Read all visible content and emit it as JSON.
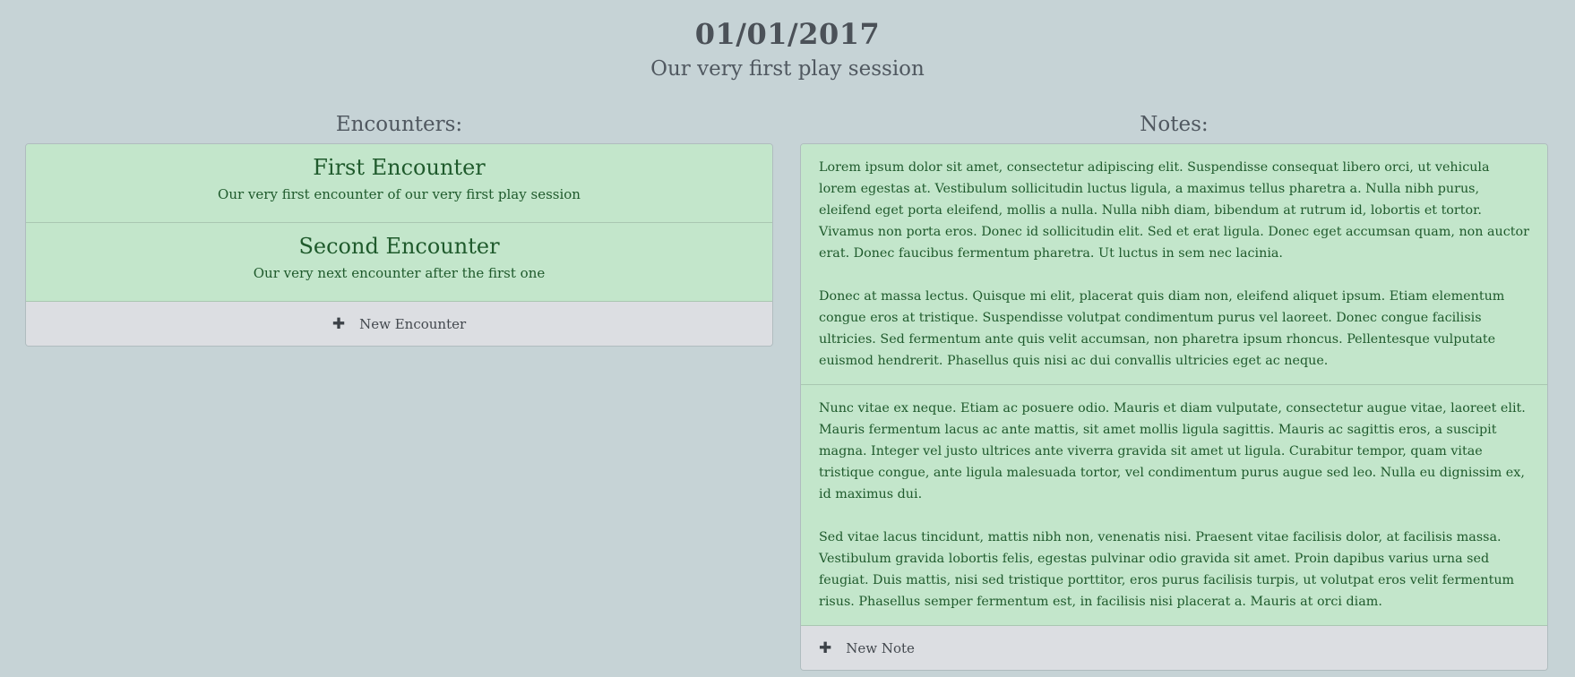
{
  "session": {
    "date": "01/01/2017",
    "subtitle": "Our very first play session"
  },
  "encounters": {
    "heading": "Encounters:",
    "items": [
      {
        "title": "First Encounter",
        "description": "Our very first encounter of our very first play session"
      },
      {
        "title": "Second Encounter",
        "description": "Our very next encounter after the first one"
      }
    ],
    "add_label": "New Encounter",
    "add_icon": "plus-icon"
  },
  "notes": {
    "heading": "Notes:",
    "items": [
      {
        "paragraphs": [
          "Lorem ipsum dolor sit amet, consectetur adipiscing elit. Suspendisse consequat libero orci, ut vehicula lorem egestas at. Vestibulum sollicitudin luctus ligula, a maximus tellus pharetra a. Nulla nibh purus, eleifend eget porta eleifend, mollis a nulla. Nulla nibh diam, bibendum at rutrum id, lobortis et tortor. Vivamus non porta eros. Donec id sollicitudin elit. Sed et erat ligula. Donec eget accumsan quam, non auctor erat. Donec faucibus fermentum pharetra. Ut luctus in sem nec lacinia.",
          "Donec at massa lectus. Quisque mi elit, placerat quis diam non, eleifend aliquet ipsum. Etiam elementum congue eros at tristique. Suspendisse volutpat condimentum purus vel laoreet. Donec congue facilisis ultricies. Sed fermentum ante quis velit accumsan, non pharetra ipsum rhoncus. Pellentesque vulputate euismod hendrerit. Phasellus quis nisi ac dui convallis ultricies eget ac neque."
        ]
      },
      {
        "paragraphs": [
          "Nunc vitae ex neque. Etiam ac posuere odio. Mauris et diam vulputate, consectetur augue vitae, laoreet elit. Mauris fermentum lacus ac ante mattis, sit amet mollis ligula sagittis. Mauris ac sagittis eros, a suscipit magna. Integer vel justo ultrices ante viverra gravida sit amet ut ligula. Curabitur tempor, quam vitae tristique congue, ante ligula malesuada tortor, vel condimentum purus augue sed leo. Nulla eu dignissim ex, id maximus dui.",
          "Sed vitae lacus tincidunt, mattis nibh non, venenatis nisi. Praesent vitae facilisis dolor, at facilisis massa. Vestibulum gravida lobortis felis, egestas pulvinar odio gravida sit amet. Proin dapibus varius urna sed feugiat. Duis mattis, nisi sed tristique porttitor, eros purus facilisis turpis, ut volutpat eros velit fermentum risus. Phasellus semper fermentum est, in facilisis nisi placerat a. Mauris at orci diam."
        ]
      }
    ],
    "add_label": "New Note",
    "add_icon": "plus-icon"
  },
  "colors": {
    "background": "#c6d3d6",
    "item_background": "#c3e6cb",
    "item_text": "#1f5a2c",
    "add_row_background": "#dcdee2"
  }
}
